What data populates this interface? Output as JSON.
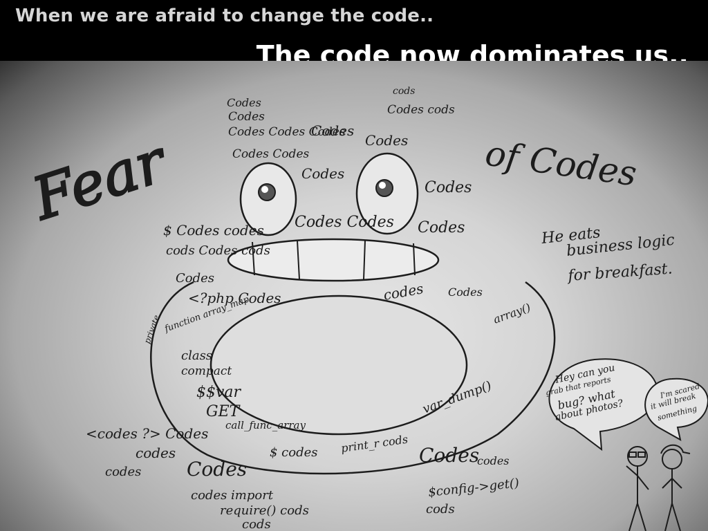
{
  "caption": {
    "top": "When we are afraid to change the code..",
    "main": "The code now dominates us.."
  },
  "drawing": {
    "title_left": "Fear",
    "title_right": "of Codes",
    "quote": [
      "He eats",
      "business logic",
      "for breakfast."
    ],
    "bubble_left": [
      "Hey can you",
      "grab that reports",
      "bug? what",
      "about photos?"
    ],
    "bubble_right": [
      "I'm scared",
      "it will break",
      "something"
    ],
    "scribbles": [
      "Codes",
      "Codes",
      "Codes Codes Codes",
      "Codes",
      "cods",
      "Codes cods",
      "Codes Codes",
      "Codes",
      "Codes",
      "Codes Codes",
      "Codes",
      "Codes",
      "$ Codes codes",
      "cods Codes cods",
      "Codes",
      "<?php Codes",
      "private",
      "function array_map",
      "class",
      "compact",
      "$$var",
      "GET",
      "<codes ?> Codes",
      "codes",
      "codes",
      "Codes",
      "codes import",
      "require() cods",
      "cods",
      "call_func_array",
      "$ codes",
      "print_r cods",
      "var_dump()",
      "array()",
      "codes",
      "Codes",
      "Codes",
      "$config->get()",
      "cods",
      "codes"
    ]
  },
  "colors": {
    "ink": "#1c1c1c",
    "caption_top": "#d6d6d6",
    "caption_main": "#ffffff"
  }
}
